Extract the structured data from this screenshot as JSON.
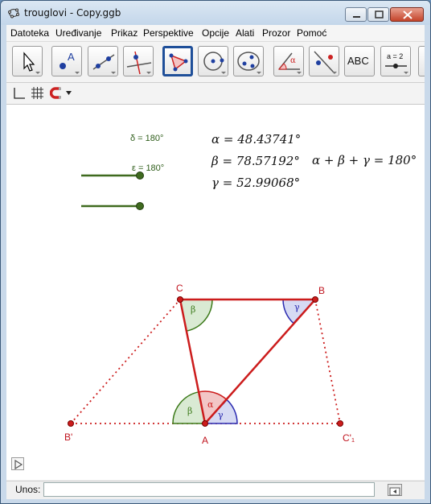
{
  "window": {
    "title": "trouglovi - Copy.ggb"
  },
  "menubar": {
    "items": [
      "Datoteka",
      "Uređivanje",
      "Prikaz",
      "Perspektive",
      "Opcije",
      "Alati",
      "Prozor",
      "Pomoć"
    ]
  },
  "toolbar": {
    "tools": [
      {
        "name": "move-tool-icon"
      },
      {
        "name": "point-tool-icon",
        "label": "A"
      },
      {
        "name": "line-tool-icon"
      },
      {
        "name": "perpendicular-line-tool-icon"
      },
      {
        "name": "polygon-tool-icon",
        "selected": true
      },
      {
        "name": "circle-tool-icon"
      },
      {
        "name": "conic-tool-icon"
      },
      {
        "name": "angle-tool-icon",
        "label": "α"
      },
      {
        "name": "reflect-tool-icon"
      },
      {
        "name": "text-tool-icon",
        "label": "ABC"
      },
      {
        "name": "slider-tool-icon",
        "label": "a = 2"
      },
      {
        "name": "more-tool-icon"
      }
    ]
  },
  "stylebar": {
    "icons": [
      "axes-icon",
      "grid-icon",
      "magnet-icon",
      "dropdown-arrow-icon"
    ]
  },
  "graphics": {
    "sliders": [
      {
        "label": "δ = 180°"
      },
      {
        "label": "ε = 180°"
      }
    ],
    "formulas": {
      "alpha": "α = 48.43741°",
      "beta": "β = 78.57192°",
      "gamma": "γ = 52.99068°",
      "sum": "α + β + γ = 180°"
    },
    "points": {
      "A": "A",
      "B": "B",
      "C": "C",
      "B_prime": "B'",
      "C_prime": "C'₁"
    },
    "angle_labels": {
      "alpha": "α",
      "beta": "β",
      "gamma": "γ"
    },
    "colors": {
      "triangle": "#cc1c1c",
      "alpha_fill": "#f2c6c6",
      "beta_fill": "#d9ead3",
      "beta_stroke": "#3c7a1a",
      "gamma_fill": "#d6daf3",
      "gamma_stroke": "#2a2ab0",
      "slider": "#3f6a1f"
    }
  },
  "inputbar": {
    "label": "Unos:",
    "value": "",
    "placeholder": ""
  }
}
